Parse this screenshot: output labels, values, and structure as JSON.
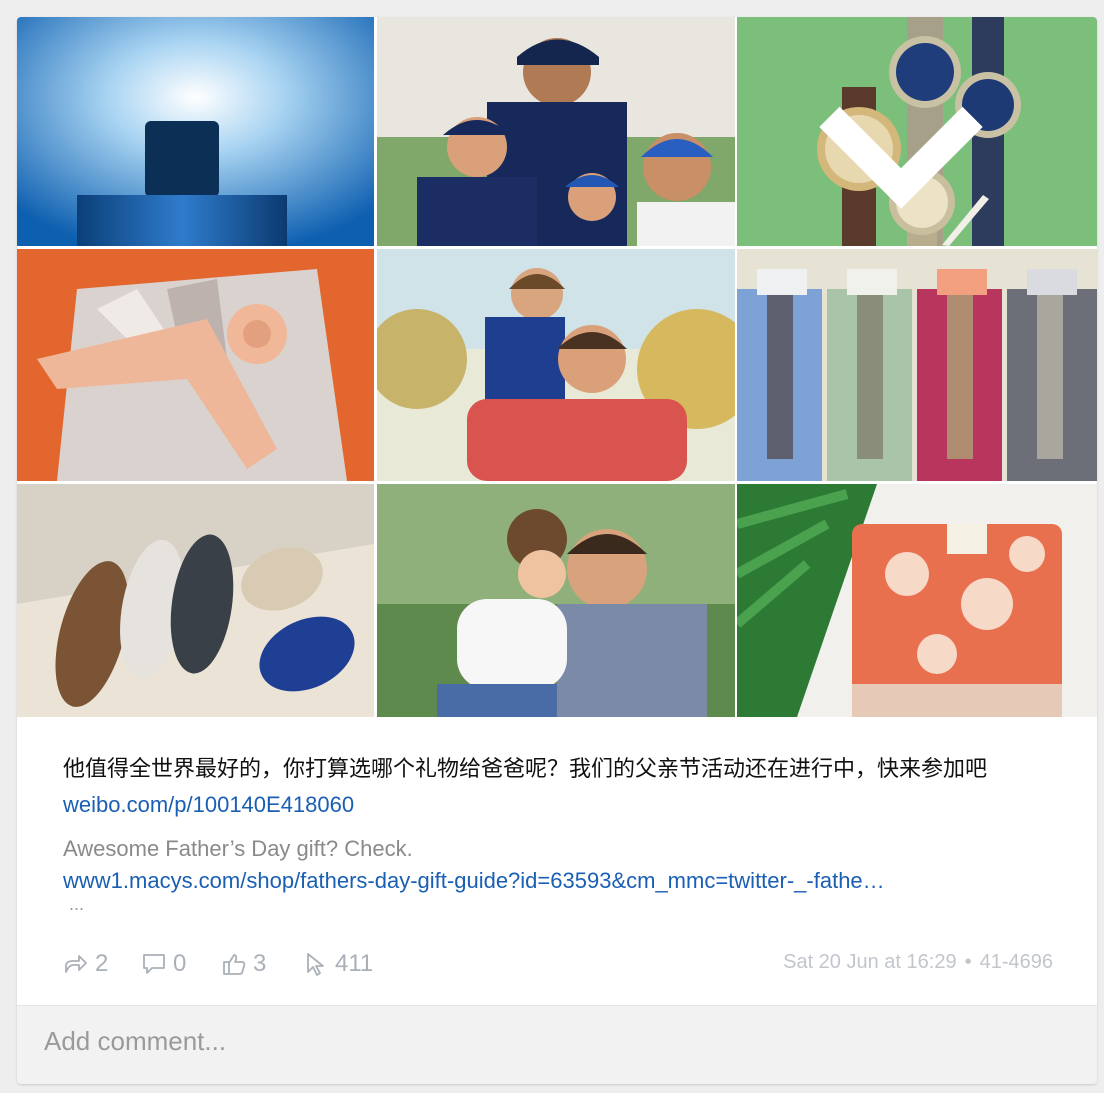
{
  "images": [
    {
      "icon": "cologne-bottle-image"
    },
    {
      "icon": "baseball-family-image"
    },
    {
      "icon": "watches-image"
    },
    {
      "icon": "shirt-and-tie-image"
    },
    {
      "icon": "father-and-son-image"
    },
    {
      "icon": "ties-and-shirts-image"
    },
    {
      "icon": "loafers-image"
    },
    {
      "icon": "father-and-daughter-image"
    },
    {
      "icon": "hawaiian-shirt-image"
    }
  ],
  "post": {
    "text": "他值得全世界最好的，你打算选哪个礼物给爸爸呢？我们的父亲节活动还在进行中，快来参加吧 ",
    "link": "weibo.com/p/100140E418060",
    "description": "Awesome Father’s Day gift? Check.",
    "url": "www1.macys.com/shop/fathers-day-gift-guide?id=63593&cm_mmc=twitter-_-fathe…",
    "more": "..."
  },
  "stats": {
    "shares": "2",
    "comments": "0",
    "likes": "3",
    "clicks": "411",
    "timestamp": "Sat 20 Jun at 16:29",
    "separator": "•",
    "id": "41-4696"
  },
  "comment": {
    "placeholder": "Add comment..."
  },
  "colors": {
    "link": "#1a5fb4",
    "muted": "#aab0b8"
  }
}
